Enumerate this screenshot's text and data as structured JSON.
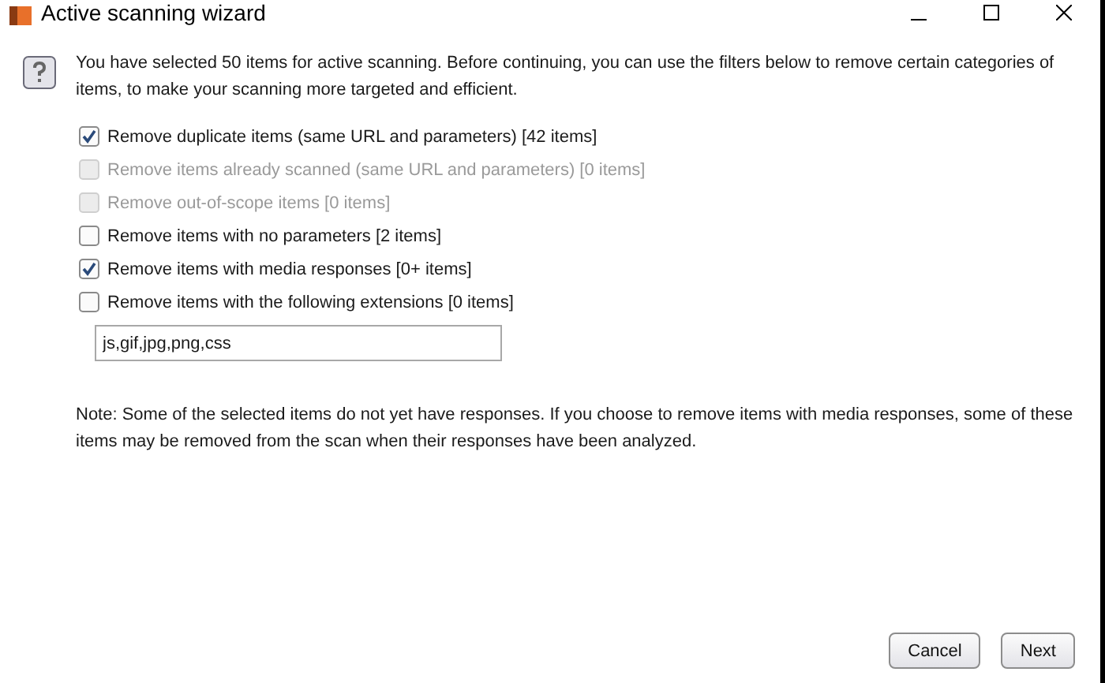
{
  "window": {
    "title": "Active scanning wizard"
  },
  "intro": "You have selected 50 items for active scanning. Before continuing, you can use the filters below to remove certain categories of items, to make your scanning more targeted and efficient.",
  "filters": [
    {
      "label": "Remove duplicate items (same URL and parameters) [42 items]",
      "checked": true,
      "disabled": false
    },
    {
      "label": "Remove items already scanned (same URL and parameters) [0 items]",
      "checked": false,
      "disabled": true
    },
    {
      "label": "Remove out-of-scope items [0 items]",
      "checked": false,
      "disabled": true
    },
    {
      "label": "Remove items with no parameters [2 items]",
      "checked": false,
      "disabled": false
    },
    {
      "label": "Remove items with media responses [0+ items]",
      "checked": true,
      "disabled": false
    },
    {
      "label": "Remove items with the following extensions [0 items]",
      "checked": false,
      "disabled": false
    }
  ],
  "extensions_field": {
    "value": "js,gif,jpg,png,css"
  },
  "note": "Note: Some of the selected items do not yet have responses. If you choose to remove items with media responses, some of these items may be removed from the scan when their responses have been analyzed.",
  "buttons": [
    "Cancel",
    "Next"
  ]
}
